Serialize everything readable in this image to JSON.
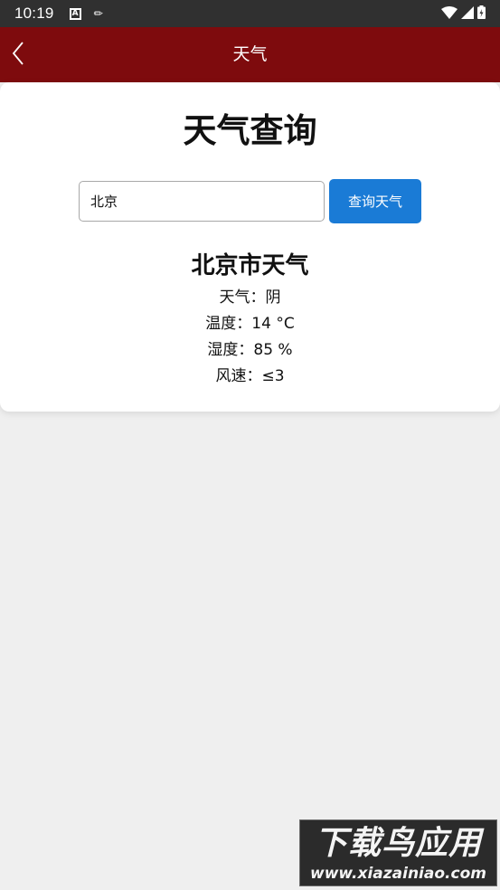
{
  "status_bar": {
    "time": "10:19",
    "icons": [
      "a-badge-icon",
      "wrench-icon",
      "wifi-icon",
      "signal-icon",
      "battery-icon"
    ]
  },
  "app_bar": {
    "title": "天气",
    "back_icon": "chevron-left-icon",
    "background": "#7e0b0d"
  },
  "main": {
    "heading": "天气查询",
    "search": {
      "value": "北京",
      "placeholder": ""
    },
    "query_button_label": "查询天气",
    "query_button_color": "#1a7bd6"
  },
  "result": {
    "title": "北京市天气",
    "lines": [
      "天气：阴",
      "温度：14 °C",
      "湿度：85 %",
      "风速：≤3"
    ]
  },
  "watermark": {
    "cn": "下载鸟应用",
    "en": "www.xiazainiao.com"
  }
}
